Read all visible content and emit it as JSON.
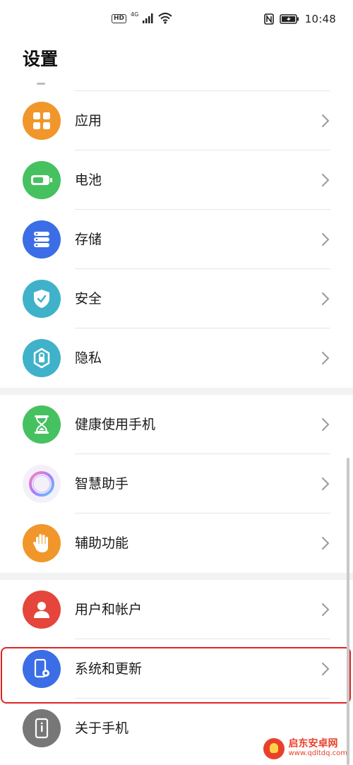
{
  "status_bar": {
    "network_badge": "HD",
    "network_type": "4G",
    "time": "10:48"
  },
  "page": {
    "title": "设置"
  },
  "sections": [
    {
      "items": [
        {
          "label": "应用",
          "icon": "apps-icon",
          "color": "#f0962b"
        },
        {
          "label": "电池",
          "icon": "battery-icon",
          "color": "#46c160"
        },
        {
          "label": "存储",
          "icon": "storage-icon",
          "color": "#3b6ee6"
        },
        {
          "label": "安全",
          "icon": "shield-icon",
          "color": "#3fb2c9"
        },
        {
          "label": "隐私",
          "icon": "privacy-lock-icon",
          "color": "#3fb2c9"
        }
      ]
    },
    {
      "items": [
        {
          "label": "健康使用手机",
          "icon": "hourglass-icon",
          "color": "#46c160"
        },
        {
          "label": "智慧助手",
          "icon": "assistant-ring-icon",
          "color": "#b27ae8"
        },
        {
          "label": "辅助功能",
          "icon": "hand-icon",
          "color": "#f0962b"
        }
      ]
    },
    {
      "items": [
        {
          "label": "用户和帐户",
          "icon": "user-icon",
          "color": "#e5453b"
        },
        {
          "label": "系统和更新",
          "icon": "system-update-icon",
          "color": "#3b6ee6"
        },
        {
          "label": "关于手机",
          "icon": "phone-info-icon",
          "color": "#777777"
        }
      ]
    }
  ],
  "highlighted_item": "系统和更新",
  "watermark": {
    "name": "启东安卓网",
    "url": "www.qdltdq.com"
  }
}
